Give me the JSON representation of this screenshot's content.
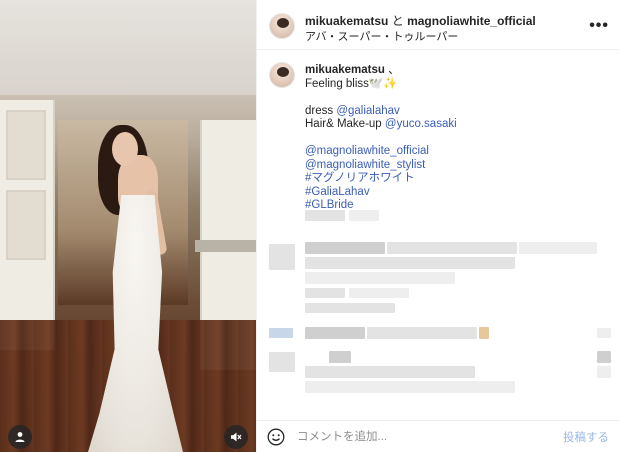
{
  "post": {
    "header": {
      "user1": "mikuakematsu",
      "joiner": "と",
      "user2": "magnoliawhite_official",
      "audio": "アバ・スーパー・トゥルーパー"
    },
    "caption": {
      "username": "mikuakematsu",
      "separator": "、",
      "line1": "Feeling bliss🕊️✨",
      "dress_label": "dress ",
      "dress_tag": "@galialahav",
      "hair_label": "Hair& Make-up ",
      "hair_tag": "@yuco.sasaki",
      "tags": [
        "@magnoliawhite_official",
        "@magnoliawhite_stylist",
        "#マグノリアホワイト",
        "#GaliaLahav",
        "#GLBride"
      ]
    },
    "footer": {
      "comment_placeholder": "コメントを追加...",
      "post_label": "投稿する"
    }
  },
  "colors": {
    "link": "#3b5db6",
    "post_disabled": "#9ab8e8"
  },
  "icons": {
    "more": "more-options-icon",
    "user": "user-tag-icon",
    "mute": "muted-audio-icon",
    "emoji": "emoji-icon"
  }
}
